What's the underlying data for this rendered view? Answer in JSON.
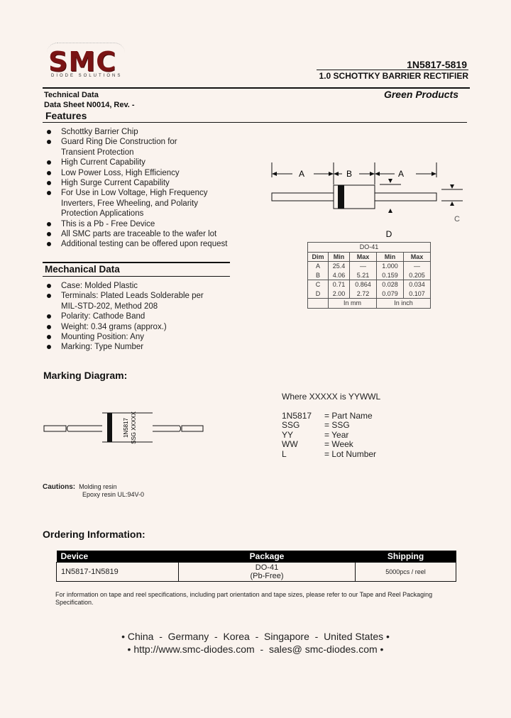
{
  "brand": {
    "logo_text": "SMC",
    "logo_tagline": "DIODE SOLUTIONS",
    "accent_color": "#7a1414"
  },
  "header": {
    "part_number": "1N5817-5819",
    "subtitle": "1.0 SCHOTTKY BARRIER RECTIFIER",
    "technical_data": "Technical Data",
    "datasheet": "Data Sheet N0014, Rev. -",
    "green_products": "Green Products"
  },
  "features": {
    "heading": "Features",
    "items": [
      [
        "Schottky Barrier Chip"
      ],
      [
        "Guard Ring Die Construction for",
        "Transient Protection"
      ],
      [
        "High Current Capability"
      ],
      [
        "Low Power Loss, High Efficiency"
      ],
      [
        "High Surge Current Capability"
      ],
      [
        "For Use in Low Voltage, High Frequency",
        "Inverters, Free Wheeling, and Polarity",
        "Protection Applications"
      ],
      [
        "This is a Pb - Free Device"
      ],
      [
        "All SMC parts are traceable to the wafer lot"
      ],
      [
        "Additional testing can be offered upon request"
      ]
    ]
  },
  "package_drawing": {
    "labels": {
      "a": "A",
      "b": "B",
      "c": "C",
      "d": "D"
    }
  },
  "dimension_table": {
    "title": "DO-41",
    "headers": [
      "Dim",
      "Min",
      "Max",
      "Min",
      "Max"
    ],
    "rows": [
      [
        "A",
        "25.4",
        "—",
        "1.000",
        "—"
      ],
      [
        "B",
        "4.06",
        "5.21",
        "0.159",
        "0.205"
      ],
      [
        "C",
        "0.71",
        "0.864",
        "0.028",
        "0.034"
      ],
      [
        "D",
        "2.00",
        "2.72",
        "0.079",
        "0.107"
      ]
    ],
    "units": [
      "In mm",
      "In inch"
    ]
  },
  "mechanical": {
    "heading": "Mechanical Data",
    "items": [
      [
        "Case: Molded Plastic"
      ],
      [
        "Terminals: Plated Leads Solderable per",
        "MIL-STD-202, Method 208"
      ],
      [
        "Polarity: Cathode Band"
      ],
      [
        "Weight: 0.34 grams (approx.)"
      ],
      [
        "Mounting Position: Any"
      ],
      [
        "Marking: Type Number"
      ]
    ]
  },
  "marking": {
    "heading": "Marking Diagram:",
    "body_line1": "1N5817",
    "body_line2": "SSG XXXXX",
    "where": "Where XXXXX is YYWWL",
    "legend": [
      {
        "key": "1N5817",
        "value": "= Part Name"
      },
      {
        "key": "SSG",
        "value": "= SSG"
      },
      {
        "key": "YY",
        "value": "= Year"
      },
      {
        "key": "WW",
        "value": "= Week"
      },
      {
        "key": "L",
        "value": "= Lot Number"
      }
    ]
  },
  "cautions": {
    "label": "Cautions:",
    "line1": "Molding resin",
    "line2": "Epoxy resin UL:94V-0"
  },
  "ordering": {
    "heading": "Ordering Information:",
    "headers": [
      "Device",
      "Package",
      "Shipping"
    ],
    "rows": [
      {
        "device": "1N5817-1N5819",
        "package_line1": "DO-41",
        "package_line2": "(Pb-Free)",
        "shipping": "5000pcs / reel"
      }
    ],
    "note": "For information on tape and reel specifications, including part orientation and tape sizes, please refer to our Tape and Reel Packaging Specification."
  },
  "footer": {
    "line1": "• China  -  Germany  -  Korea  -  Singapore  -  United States •",
    "line2": "• http://www.smc-diodes.com  -  sales@ smc-diodes.com •"
  }
}
